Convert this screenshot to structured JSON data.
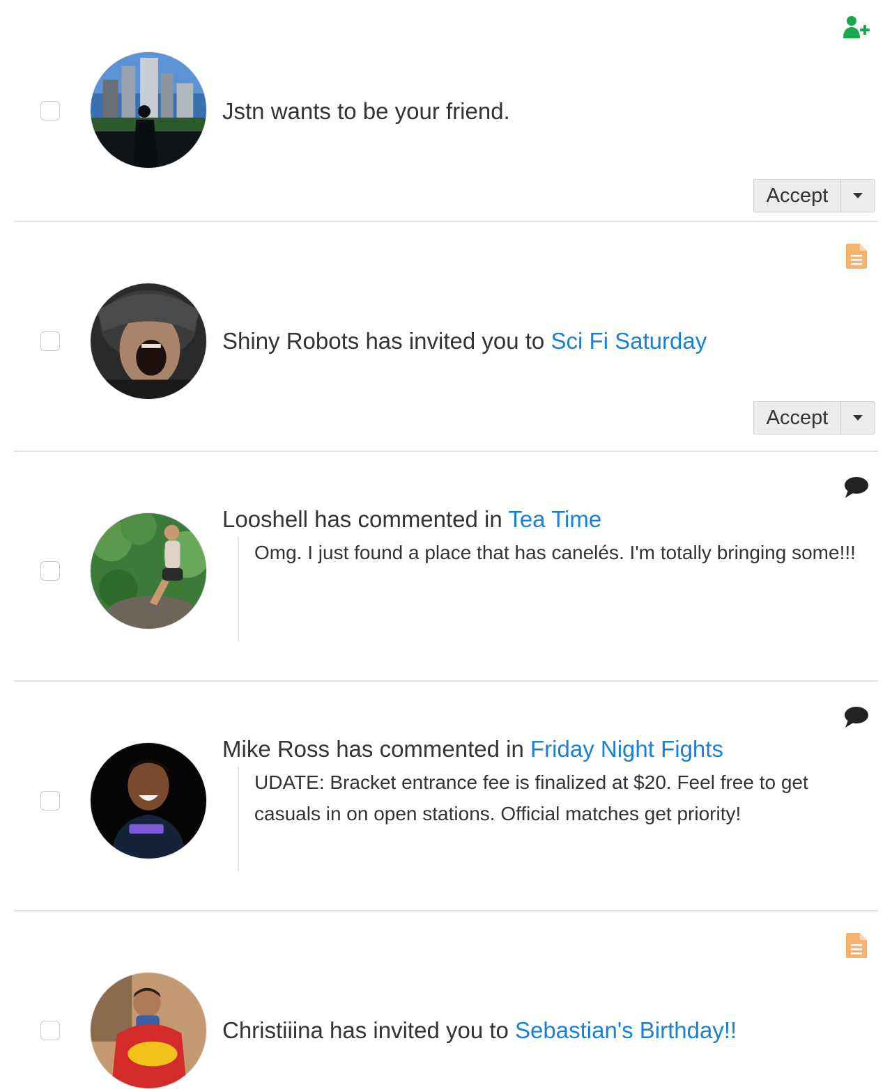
{
  "notifications": [
    {
      "type_icon": "add-user-icon",
      "type_icon_color": "#1aa84f",
      "avatar": "city-skyline-silhouette-avatar",
      "text": "Jstn wants to be your friend.",
      "link": "",
      "accept_label": "Accept"
    },
    {
      "type_icon": "document-icon",
      "type_icon_color": "#f7b36b",
      "avatar": "soldier-helmet-shouting-avatar",
      "text": "Shiny Robots has invited you to ",
      "link": "Sci Fi Saturday",
      "accept_label": "Accept"
    },
    {
      "type_icon": "comment-icon",
      "type_icon_color": "#222222",
      "avatar": "woman-on-rock-forest-avatar",
      "text": "Looshell has commented in ",
      "link": "Tea Time",
      "comment": "Omg. I just found a place that has canelés. I'm totally bringing some!!!"
    },
    {
      "type_icon": "comment-icon",
      "type_icon_color": "#222222",
      "avatar": "smiling-man-twitch-shirt-avatar",
      "text": "Mike Ross has commented in ",
      "link": "Friday Night Fights",
      "comment": "UDATE: Bracket entrance fee is finalized at $20. Feel free to get casuals in on open stations. Official matches get priority!"
    },
    {
      "type_icon": "document-icon",
      "type_icon_color": "#f7b36b",
      "avatar": "child-in-toy-car-avatar",
      "text": "Christiiina has invited you to ",
      "link": "Sebastian's Birthday!!"
    }
  ],
  "colors": {
    "link": "#1a7fd6",
    "text": "#333333",
    "divider": "#e2e2e2"
  }
}
